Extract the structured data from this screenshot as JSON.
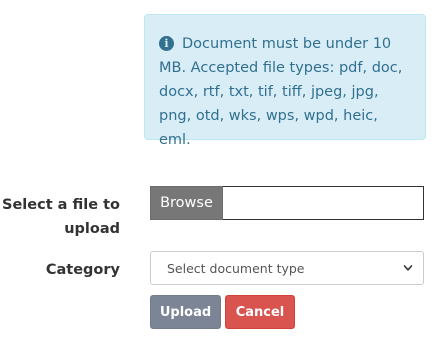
{
  "notice": {
    "icon": "info-icon",
    "text": "Document must be under 10 MB. Accepted file types: pdf, doc, docx, rtf, txt, tif, tiff, jpeg, jpg, png, otd, wks, wps, wpd, heic, eml."
  },
  "file_field": {
    "label": "Select a file to upload",
    "browse_label": "Browse",
    "value": ""
  },
  "category_field": {
    "label": "Category",
    "selected": "Select document type"
  },
  "actions": {
    "upload_label": "Upload",
    "cancel_label": "Cancel"
  },
  "colors": {
    "alert_bg": "#d9edf7",
    "alert_text": "#31708f",
    "upload_bg": "#7c8596",
    "cancel_bg": "#d9534f",
    "browse_bg": "#777777"
  }
}
